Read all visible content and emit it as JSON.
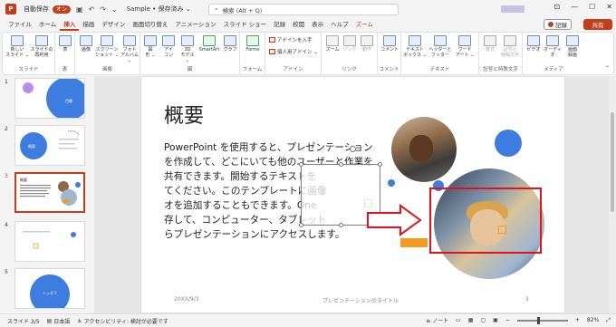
{
  "titlebar": {
    "logo": "P",
    "autosave_label": "自動保存",
    "autosave_state": "オン",
    "doc_title": "Sample • 保存済み ⌄",
    "search_text": "検索 (Alt + Q)"
  },
  "tabs": [
    "ファイル",
    "ホーム",
    "挿入",
    "描画",
    "デザイン",
    "画面切り替え",
    "アニメーション",
    "スライド ショー",
    "記録",
    "校閲",
    "表示",
    "ヘルプ",
    "ズーム"
  ],
  "record_label": "記録",
  "share_label": "共有",
  "ribbon": {
    "groups": {
      "slides": "スライド",
      "table": "表",
      "images": "画像",
      "illustrations": "図",
      "forms": "フォーム",
      "addins": "アドイン",
      "links": "リンク",
      "comments": "コメント",
      "text": "テキスト",
      "symbols": "記号と特殊文字",
      "media": "メディア"
    },
    "buttons": {
      "new_slide": "新しい\nスライド ⌄",
      "reuse_slide": "スライドの\n再利用",
      "table": "表",
      "picture": "画像",
      "screenshot": "スクリーン\nショット ⌄",
      "photo_album": "フォト\nアルバム ⌄",
      "shapes": "図\n形 ⌄",
      "icons": "アイ\nコン",
      "3d": "3D\nモデル ⌄",
      "smartart": "SmartArt",
      "chart": "グラフ",
      "forms": "Forms",
      "get_addins": "アドインを入手",
      "my_addins": "個人用アドイン ⌄",
      "zoom": "ズーム",
      "link": "リンク",
      "action": "動作",
      "comment": "コメント",
      "textbox": "テキスト\nボックス ⌄",
      "header_footer": "ヘッダーと\nフッター",
      "wordart": "ワード\nアート ⌄",
      "equation": "数式",
      "symbol": "記号と\n特殊文字",
      "video": "ビデオ",
      "audio": "オーディ\nオ",
      "screen_recording": "画面\n録画"
    }
  },
  "thumbnails": [
    {
      "num": "1",
      "star": "",
      "text": "目標"
    },
    {
      "num": "2",
      "star": "",
      "text": "概要"
    },
    {
      "num": "3",
      "star": "",
      "text": "概要"
    },
    {
      "num": "4",
      "star": "",
      "text": ""
    },
    {
      "num": "5",
      "star": "",
      "text": "ヘッダ 1"
    }
  ],
  "slide": {
    "title": "概要",
    "body": "PowerPoint を使用すると、プレゼンテーション\nを作成して、どこにいても他のユーザーと作業を\n共有できます。開始するテキストを\nてください。このテンプレートに画像\nオを追加することもできます。One\n存して、コンピューター、タブレット\nらプレゼンテーションにアクセスします。",
    "date": "20XX/9/3",
    "footer": "プレゼンテーションのタイトル",
    "page": "3"
  },
  "colors": {
    "accent": "#c43e1c",
    "blue": "#3d7de0",
    "orange": "#f39a21",
    "highlight_red": "#e3121a"
  },
  "status": {
    "slide_info": "スライド 3/5",
    "language": "日本語",
    "accessibility": "アクセシビリティ: 検討が必要です",
    "notes": "ノート",
    "zoom": "82%"
  }
}
